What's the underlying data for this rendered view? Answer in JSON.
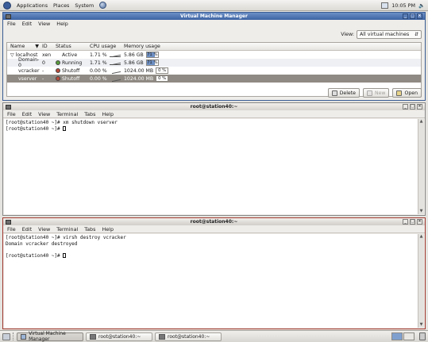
{
  "top_panel": {
    "menus": [
      "Applications",
      "Places",
      "System"
    ],
    "clock": "10:05 PM"
  },
  "vmm": {
    "title": "Virtual Machine Manager",
    "menu": [
      "File",
      "Edit",
      "View",
      "Help"
    ],
    "view_label": "View:",
    "view_value": "All virtual machines",
    "columns": [
      "Name",
      "ID",
      "Status",
      "CPU usage",
      "Memory usage"
    ],
    "rows": [
      {
        "name": "localhost",
        "id": "xen",
        "status": "Active",
        "cpu": "1.71 %",
        "mem": "5.86 GB",
        "mem_pct": "71 %",
        "mem_fraction": 0.71
      },
      {
        "name": "Domain-0",
        "id": "0",
        "status": "Running",
        "cpu": "1.71 %",
        "mem": "5.86 GB",
        "mem_pct": "71 %",
        "mem_fraction": 0.71
      },
      {
        "name": "vcracker",
        "id": "-",
        "status": "Shutoff",
        "cpu": "0.00 %",
        "mem": "1024.00 MB",
        "mem_pct": "0 %",
        "mem_fraction": 0
      },
      {
        "name": "vserver",
        "id": "-",
        "status": "Shutoff",
        "cpu": "0.00 %",
        "mem": "1024.00 MB",
        "mem_pct": "0 %",
        "mem_fraction": 0
      }
    ],
    "buttons": {
      "delete": "Delete",
      "new": "New",
      "open": "Open"
    }
  },
  "term1": {
    "title": "root@station40:~",
    "menu": [
      "File",
      "Edit",
      "View",
      "Terminal",
      "Tabs",
      "Help"
    ],
    "lines": [
      "[root@station40 ~]# xm shutdown vserver",
      "[root@station40 ~]# "
    ]
  },
  "term2": {
    "title": "root@station40:~",
    "menu": [
      "File",
      "Edit",
      "View",
      "Terminal",
      "Tabs",
      "Help"
    ],
    "lines": [
      "[root@station40 ~]# virsh destroy vcracker",
      "Domain vcracker destroyed",
      "",
      "[root@station40 ~]# "
    ]
  },
  "taskbar": {
    "tasks": [
      "Virtual Machine Manager",
      "root@station40:~",
      "root@station40:~"
    ]
  }
}
